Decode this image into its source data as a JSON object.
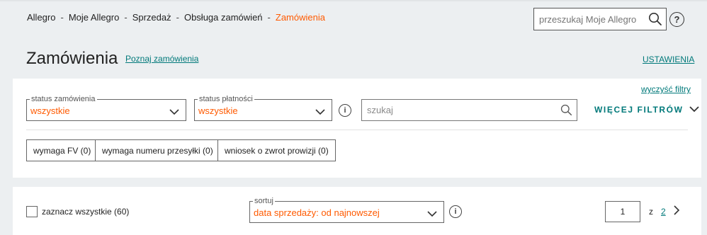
{
  "breadcrumb": {
    "items": [
      "Allegro",
      "Moje Allegro",
      "Sprzedaż",
      "Obsługa zamówień"
    ],
    "current": "Zamówienia",
    "separator": "-"
  },
  "top_search": {
    "placeholder": "przeszukaj Moje Allegro",
    "icon": "search-icon"
  },
  "help": {
    "icon": "help-icon",
    "glyph": "?"
  },
  "header": {
    "title": "Zamówienia",
    "learn_link": "Poznaj zamówienia",
    "settings_link": "USTAWIENIA"
  },
  "filters": {
    "clear_link": "wyczyść filtry",
    "order_status": {
      "label": "status zamówienia",
      "value": "wszystkie"
    },
    "payment_status": {
      "label": "status płatności",
      "value": "wszystkie"
    },
    "search": {
      "placeholder": "szukaj"
    },
    "more_filters": "WIĘCEJ FILTRÓW",
    "chips": [
      {
        "label": "wymaga FV (0)"
      },
      {
        "label": "wymaga numeru przesyłki (0)"
      },
      {
        "label": "wniosek o zwrot prowizji (0)"
      }
    ]
  },
  "list": {
    "select_all": "zaznacz wszystkie (60)",
    "sort": {
      "label": "sortuj",
      "value": "data sprzedaży: od najnowszej"
    },
    "pagination": {
      "current": "1",
      "of": "z",
      "total": "2"
    }
  },
  "colors": {
    "accent": "#ff5a00",
    "link": "#00797a",
    "background": "#eceff1"
  }
}
